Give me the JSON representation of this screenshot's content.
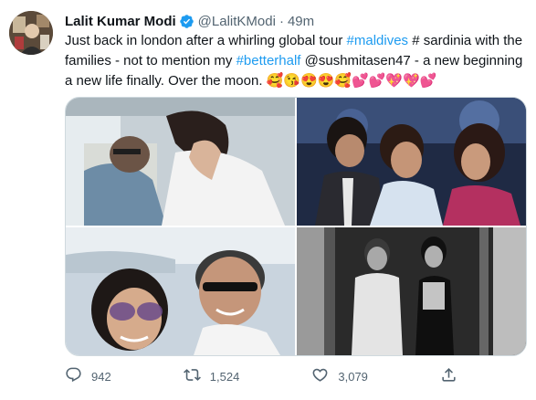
{
  "author": {
    "display_name": "Lalit Kumar Modi",
    "handle": "@LalitKModi",
    "separator": "·",
    "time": "49m",
    "verified": true
  },
  "tweet": {
    "segments": [
      {
        "text": "Just back in london after a whirling global tour ",
        "type": "text"
      },
      {
        "text": "#maldives",
        "type": "hashtag"
      },
      {
        "text": " # sardinia with the families - not to mention my ",
        "type": "text"
      },
      {
        "text": "#betterhalf",
        "type": "hashtag"
      },
      {
        "text": " @sushmitasen47 - a new beginning a new life finally. Over the moon. ",
        "type": "text"
      },
      {
        "text": "🥰😘😍😍🥰💕💕💖💖💕",
        "type": "emoji"
      }
    ]
  },
  "media": {
    "count": 4
  },
  "actions": {
    "reply_count": "942",
    "retweet_count": "1,524",
    "like_count": "3,079"
  },
  "colors": {
    "accent": "#1d9bf0",
    "secondary_text": "#536471",
    "primary_text": "#0f1419",
    "border": "#cfd9de"
  },
  "icons": {
    "verified": "verified-badge-icon",
    "reply": "reply-icon",
    "retweet": "retweet-icon",
    "like": "heart-icon",
    "share": "share-icon"
  }
}
